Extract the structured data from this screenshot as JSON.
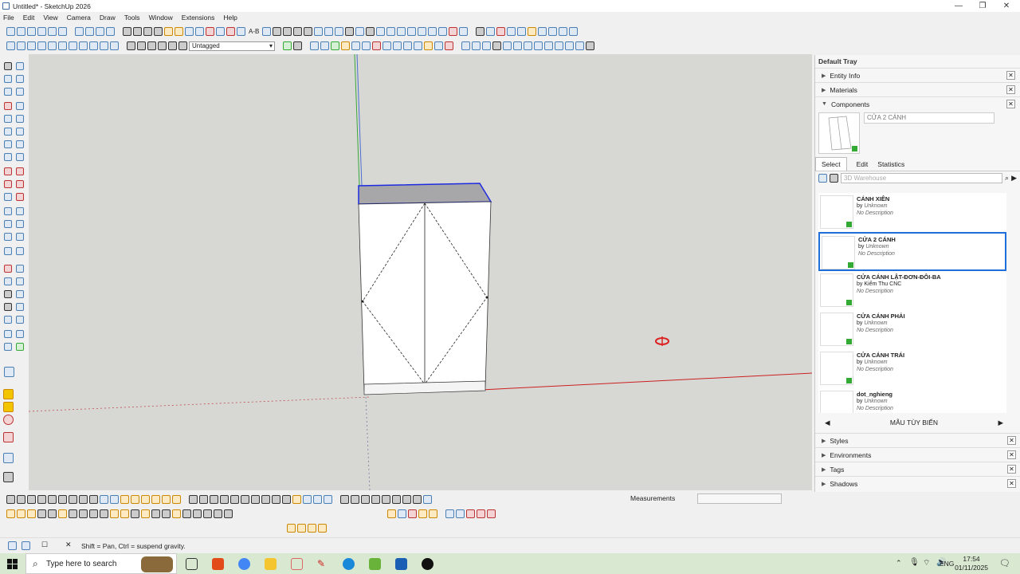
{
  "window": {
    "title": "Untitled* - SketchUp 2026"
  },
  "menu": [
    "File",
    "Edit",
    "View",
    "Camera",
    "Draw",
    "Tools",
    "Window",
    "Extensions",
    "Help"
  ],
  "toolbar": {
    "tag_select": "Untagged",
    "text_tool_label": "A-B"
  },
  "tray": {
    "title": "Default Tray",
    "panels_top": [
      "Entity Info",
      "Materials",
      "Components"
    ],
    "component_name": "CỬA 2 CÁNH",
    "tabs": [
      "Select",
      "Edit",
      "Statistics"
    ],
    "search_placeholder": "3D Warehouse",
    "items": [
      {
        "name": "CÁNH XIÊN",
        "by": "by",
        "author": "Unknown",
        "desc": "No Description"
      },
      {
        "name": "CỬA 2 CÁNH",
        "by": "by",
        "author": "Unknown",
        "desc": "No Description"
      },
      {
        "name": "CỬA CÁNH LẬT-ĐƠN-ĐÔI-BA",
        "by": "by",
        "author": "Kiểm Thu CNC",
        "desc": "No Description"
      },
      {
        "name": "CỬA CÁNH PHẢI",
        "by": "by",
        "author": "Unknown",
        "desc": "No Description"
      },
      {
        "name": "CỬA CÁNH TRÁI",
        "by": "by",
        "author": "Unknown",
        "desc": "No Description"
      },
      {
        "name": "dot_nghieng",
        "by": "by",
        "author": "Unknown",
        "desc": "No Description"
      }
    ],
    "collection": "MẪU TÙY BIẾN",
    "panels_bottom": [
      "Styles",
      "Environments",
      "Tags",
      "Shadows"
    ]
  },
  "measurements": {
    "label": "Measurements"
  },
  "status": {
    "hint": "Shift = Pan, Ctrl = suspend gravity."
  },
  "taskbar": {
    "search": "Type here to search",
    "lang": "ENG",
    "time": "17:54",
    "date": "01/11/2025"
  }
}
